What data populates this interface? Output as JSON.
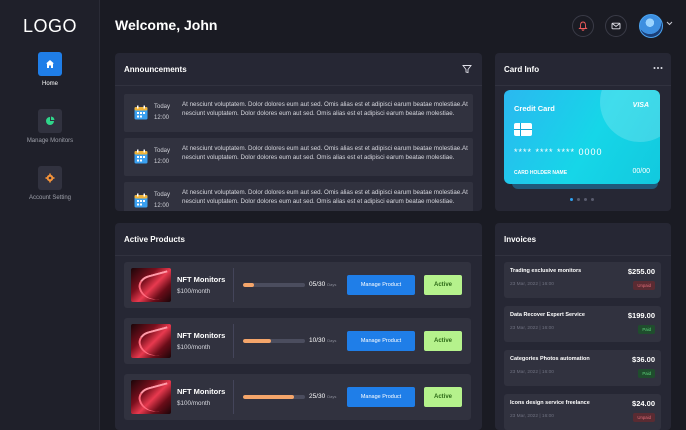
{
  "sidebar": {
    "logo": "LOGO",
    "items": [
      {
        "label": "Home",
        "icon": "home-icon",
        "active": true
      },
      {
        "label": "Manage Monitors",
        "icon": "pie-chart-icon",
        "active": false
      },
      {
        "label": "Account Setting",
        "icon": "gear-icon",
        "active": false
      }
    ]
  },
  "header": {
    "title": "Welcome, John",
    "icons": [
      "bell-icon",
      "mail-icon",
      "avatar",
      "chevron-down-icon"
    ]
  },
  "announcements": {
    "title": "Announcements",
    "filter_icon": "filter-icon",
    "items": [
      {
        "day": "Today",
        "time": "12:00",
        "text": "At nesciunt voluptatem. Dolor dolores eum aut sed. Omis alias est et adipisci earum beatae molestiae.At nesciunt voluptatem. Dolor dolores eum aut sed. Omis alias est et adipisci earum beatae molestiae."
      },
      {
        "day": "Today",
        "time": "12:00",
        "text": "At nesciunt voluptatem. Dolor dolores eum aut sed. Omis alias est et adipisci earum beatae molestiae.At nesciunt voluptatem. Dolor dolores eum aut sed. Omis alias est et adipisci earum beatae molestiae."
      },
      {
        "day": "Today",
        "time": "12:00",
        "text": "At nesciunt voluptatem. Dolor dolores eum aut sed. Omis alias est et adipisci earum beatae molestiae.At nesciunt voluptatem. Dolor dolores eum aut sed. Omis alias est et adipisci earum beatae molestiae."
      }
    ]
  },
  "card_info": {
    "title": "Card Info",
    "menu_icon": "more-horizontal-icon",
    "card": {
      "title": "Credit Card",
      "brand": "VISA",
      "number": "**** **** **** 0000",
      "holder": "CARD HOLDER NAME",
      "expiry": "00/00"
    },
    "carousel_count": 4,
    "carousel_active": 0
  },
  "products": {
    "title": "Active Products",
    "items": [
      {
        "name": "NFT Monitors",
        "price": "$100/month",
        "count": "05/30",
        "days": "Days",
        "progress": 0.17,
        "action": "Manage Product",
        "status": "Active"
      },
      {
        "name": "NFT Monitors",
        "price": "$100/month",
        "count": "10/30",
        "days": "Days",
        "progress": 0.45,
        "action": "Manage Product",
        "status": "Active"
      },
      {
        "name": "NFT Monitors",
        "price": "$100/month",
        "count": "25/30",
        "days": "Days",
        "progress": 0.83,
        "action": "Manage Product",
        "status": "Active"
      }
    ]
  },
  "invoices": {
    "title": "Invoices",
    "items": [
      {
        "name": "Trading exclusive monitors",
        "date": "23 Mar, 2022 | 16:00",
        "amount": "$255.00",
        "status": "Unpaid"
      },
      {
        "name": "Data Recover Expert Service",
        "date": "23 Mar, 2022 | 16:00",
        "amount": "$199.00",
        "status": "Paid"
      },
      {
        "name": "Categories Photos automation",
        "date": "23 Mar, 2022 | 16:00",
        "amount": "$36.00",
        "status": "Paid"
      },
      {
        "name": "Icons design service freelance",
        "date": "23 Mar, 2022 | 16:00",
        "amount": "$24.00",
        "status": "Unpaid"
      }
    ]
  },
  "colors": {
    "background": "#1a1b23",
    "panel": "#262734",
    "accent_blue": "#1f7ee8",
    "active_green": "#b5f28c",
    "progress_orange": "#f4a56a"
  }
}
